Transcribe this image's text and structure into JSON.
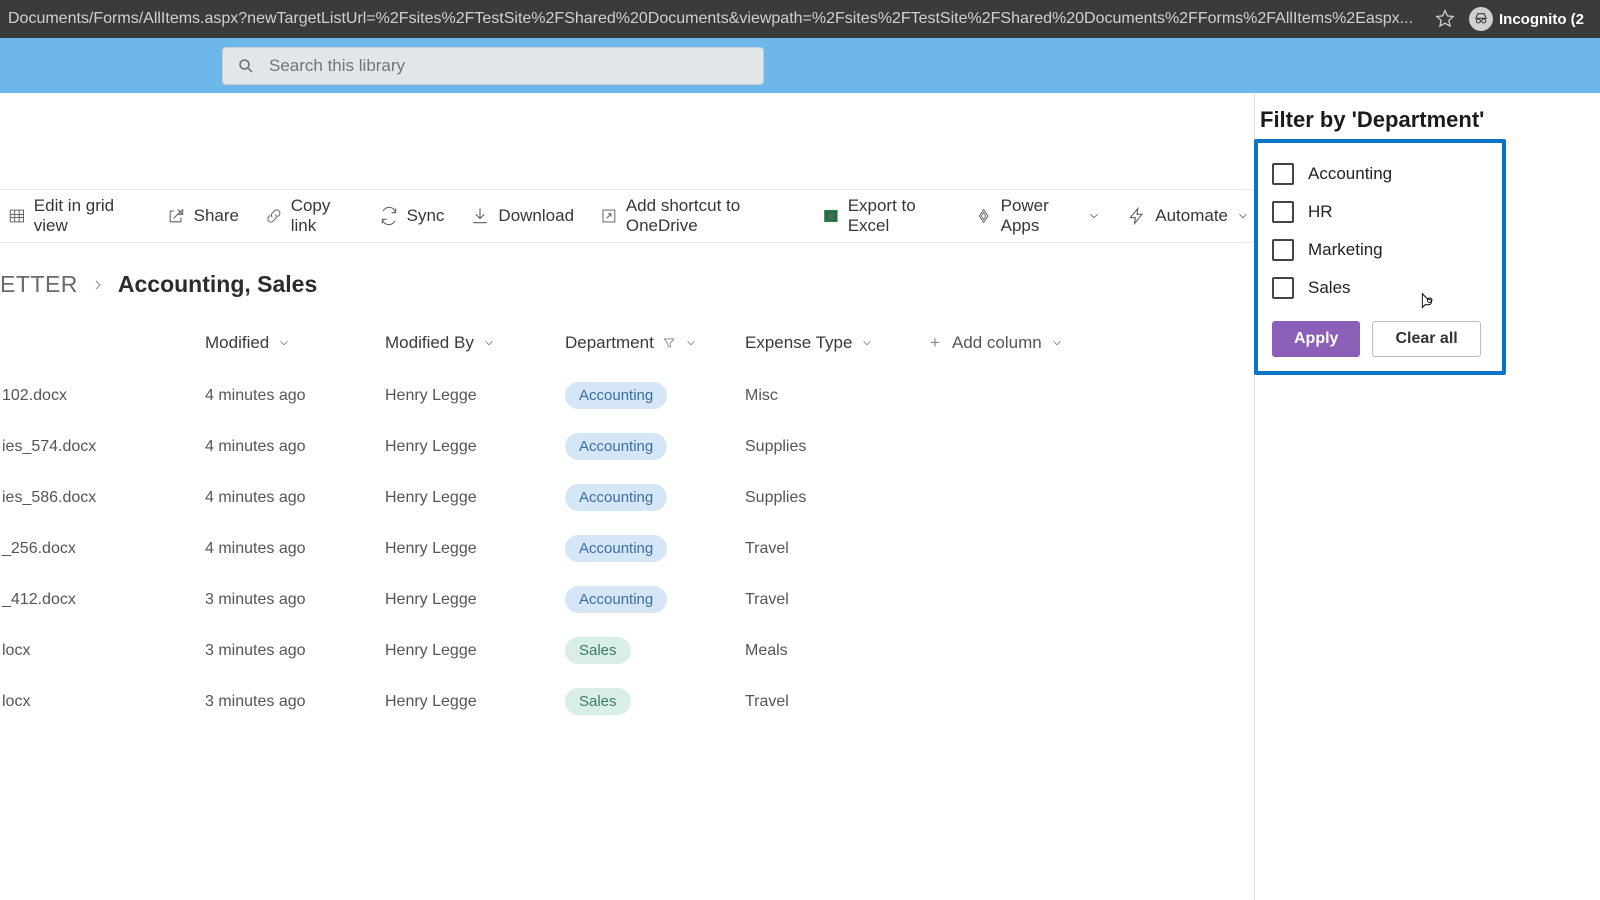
{
  "browser": {
    "url": "Documents/Forms/AllItems.aspx?newTargetListUrl=%2Fsites%2FTestSite%2FShared%20Documents&viewpath=%2Fsites%2FTestSite%2FShared%20Documents%2FForms%2FAllItems%2Easpx...",
    "incognito_label": "Incognito (2"
  },
  "search": {
    "placeholder": "Search this library"
  },
  "toolbar": {
    "edit_grid": "Edit in grid view",
    "share": "Share",
    "copy_link": "Copy link",
    "sync": "Sync",
    "download": "Download",
    "shortcut": "Add shortcut to OneDrive",
    "export_excel": "Export to Excel",
    "power_apps": "Power Apps",
    "automate": "Automate"
  },
  "breadcrumb": {
    "root": "ETTER",
    "leaf": "Accounting, Sales"
  },
  "columns": {
    "modified": "Modified",
    "modified_by": "Modified By",
    "department": "Department",
    "expense_type": "Expense Type",
    "add": "Add column"
  },
  "rows": [
    {
      "name": "102.docx",
      "modified": "4 minutes ago",
      "by": "Henry Legge",
      "dept": "Accounting",
      "exp": "Misc"
    },
    {
      "name": "ies_574.docx",
      "modified": "4 minutes ago",
      "by": "Henry Legge",
      "dept": "Accounting",
      "exp": "Supplies"
    },
    {
      "name": "ies_586.docx",
      "modified": "4 minutes ago",
      "by": "Henry Legge",
      "dept": "Accounting",
      "exp": "Supplies"
    },
    {
      "name": "_256.docx",
      "modified": "4 minutes ago",
      "by": "Henry Legge",
      "dept": "Accounting",
      "exp": "Travel"
    },
    {
      "name": "_412.docx",
      "modified": "3 minutes ago",
      "by": "Henry Legge",
      "dept": "Accounting",
      "exp": "Travel"
    },
    {
      "name": "locx",
      "modified": "3 minutes ago",
      "by": "Henry Legge",
      "dept": "Sales",
      "exp": "Meals"
    },
    {
      "name": "locx",
      "modified": "3 minutes ago",
      "by": "Henry Legge",
      "dept": "Sales",
      "exp": "Travel"
    }
  ],
  "filter": {
    "title": "Filter by 'Department'",
    "options": [
      "Accounting",
      "HR",
      "Marketing",
      "Sales"
    ],
    "apply": "Apply",
    "clear": "Clear all"
  }
}
